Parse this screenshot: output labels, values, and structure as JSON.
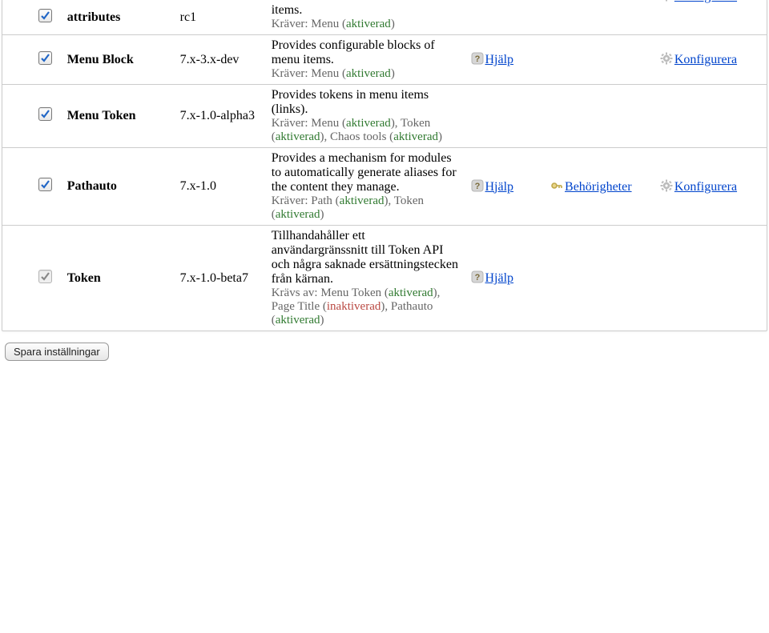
{
  "actions": {
    "help": "Hjälp",
    "permissions": "Behörigheter",
    "configure": "Konfigurera"
  },
  "save_button": "Spara inställningar",
  "strings": {
    "requires_prefix": "Kräver: ",
    "required_by_prefix": "Krävs av: ",
    "activated": "aktiverad",
    "inactivated": "inaktiverad"
  },
  "rows": [
    {
      "cb": {
        "checked": true,
        "disabled": false
      },
      "name": "attributes",
      "version": "rc1",
      "desc": "items.",
      "requires": [
        {
          "module": "Menu",
          "status": "activated"
        }
      ],
      "help": false,
      "permissions": false,
      "configure": false,
      "configure_overflow": true
    },
    {
      "cb": {
        "checked": true,
        "disabled": false
      },
      "name": "Menu Block",
      "version": "7.x-3.x-dev",
      "desc": "Provides configurable blocks of menu items.",
      "requires": [
        {
          "module": "Menu",
          "status": "activated"
        }
      ],
      "help": true,
      "permissions": false,
      "configure": true
    },
    {
      "cb": {
        "checked": true,
        "disabled": false
      },
      "name": "Menu Token",
      "version": "7.x-1.0-alpha3",
      "desc": "Provides tokens in menu items (links).",
      "requires": [
        {
          "module": "Menu",
          "status": "activated"
        },
        {
          "module": "Token",
          "status": "activated"
        },
        {
          "module": "Chaos tools",
          "status": "activated"
        }
      ],
      "help": false,
      "permissions": false,
      "configure": false
    },
    {
      "cb": {
        "checked": true,
        "disabled": false
      },
      "name": "Pathauto",
      "version": "7.x-1.0",
      "desc": "Provides a mechanism for modules to automatically generate aliases for the content they manage.",
      "requires": [
        {
          "module": "Path",
          "status": "activated"
        },
        {
          "module": "Token",
          "status": "activated"
        }
      ],
      "help": true,
      "permissions": true,
      "configure": true
    },
    {
      "cb": {
        "checked": true,
        "disabled": true
      },
      "name": "Token",
      "version": "7.x-1.0-beta7",
      "desc": "Tillhandahåller ett användargränssnitt till Token API och några saknade ersättningstecken från kärnan.",
      "required_by": [
        {
          "module": "Menu Token",
          "status": "activated"
        },
        {
          "module": "Page Title",
          "status": "inactivated"
        },
        {
          "module": "Pathauto",
          "status": "activated"
        }
      ],
      "help": true,
      "permissions": false,
      "configure": false
    }
  ]
}
